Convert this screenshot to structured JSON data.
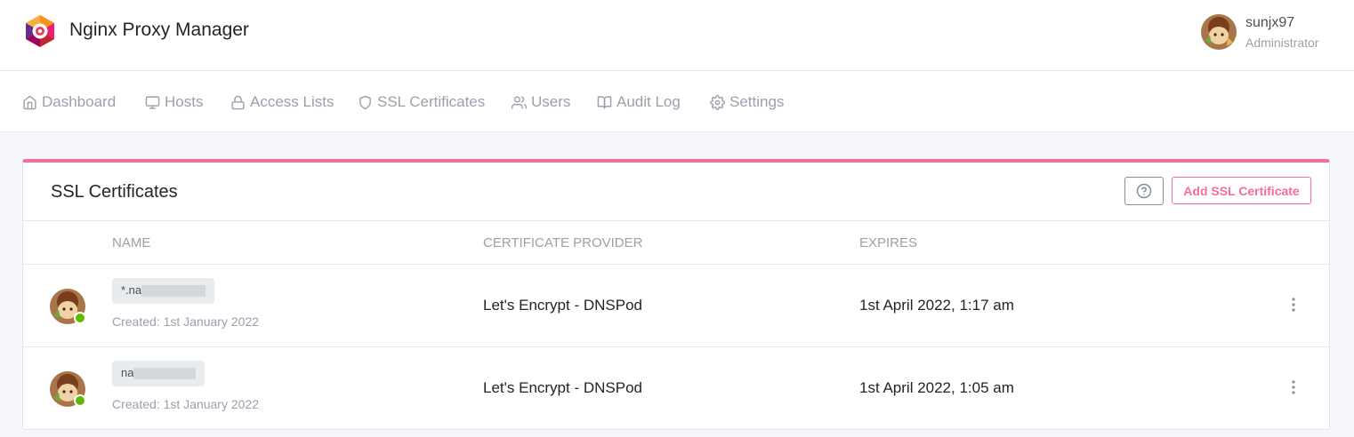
{
  "app": {
    "title": "Nginx Proxy Manager"
  },
  "user": {
    "name": "sunjx97",
    "role": "Administrator"
  },
  "nav": {
    "items": [
      {
        "label": "Dashboard",
        "icon": "home-icon"
      },
      {
        "label": "Hosts",
        "icon": "monitor-icon"
      },
      {
        "label": "Access Lists",
        "icon": "lock-icon"
      },
      {
        "label": "SSL Certificates",
        "icon": "shield-icon"
      },
      {
        "label": "Users",
        "icon": "users-icon"
      },
      {
        "label": "Audit Log",
        "icon": "book-open-icon"
      },
      {
        "label": "Settings",
        "icon": "gear-icon"
      }
    ]
  },
  "page": {
    "title": "SSL Certificates",
    "add_button": "Add SSL Certificate",
    "accent_color": "#f66d9b"
  },
  "table": {
    "columns": [
      "Name",
      "Certificate Provider",
      "Expires"
    ],
    "rows": [
      {
        "domain": "*.na",
        "created": "Created: 1st January 2022",
        "provider": "Let's Encrypt - DNSPod",
        "expires": "1st April 2022, 1:17 am",
        "status": "online"
      },
      {
        "domain": "na",
        "created": "Created: 1st January 2022",
        "provider": "Let's Encrypt - DNSPod",
        "expires": "1st April 2022, 1:05 am",
        "status": "online"
      }
    ]
  }
}
